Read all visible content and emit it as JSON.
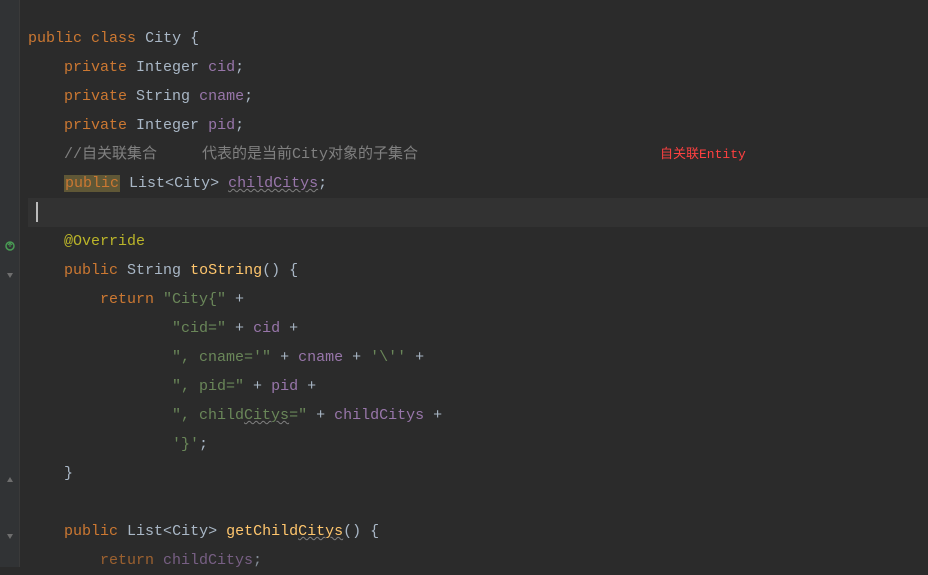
{
  "code": {
    "line1": {
      "kw1": "public",
      "kw2": "class",
      "name": "City",
      "brace": " {"
    },
    "line2": {
      "kw": "private",
      "type": "Integer",
      "field": "cid",
      "semi": ";"
    },
    "line3": {
      "kw": "private",
      "type": "String",
      "field": "cname",
      "semi": ";"
    },
    "line4": {
      "kw": "private",
      "type": "Integer",
      "field": "pid",
      "semi": ";"
    },
    "line5": {
      "comment": "//自关联集合     代表的是当前City对象的子集合"
    },
    "line6": {
      "kw": "public",
      "type1": "List<",
      "type2": "City",
      "type3": ">",
      "field": "childCitys",
      "semi": ";"
    },
    "line7": {
      "ann": "@Override"
    },
    "line8": {
      "kw": "public",
      "type": "String",
      "method": "toString",
      "parens": "()",
      "brace": " {"
    },
    "line9": {
      "kw": "return ",
      "str": "\"City{\"",
      "op": " +"
    },
    "line10": {
      "str": "\"cid=\"",
      "op1": " + ",
      "field": "cid",
      "op2": " +"
    },
    "line11": {
      "str": "\", cname='\"",
      "op1": " + ",
      "field": "cname",
      "op2": " + ",
      "str2": "'\\''",
      "op3": " +"
    },
    "line12": {
      "str": "\", pid=\"",
      "op1": " + ",
      "field": "pid",
      "op2": " +"
    },
    "line13": {
      "str1": "\", child",
      "str2": "Citys",
      "str3": "=\"",
      "op1": " + ",
      "field": "childCitys",
      "op2": " +"
    },
    "line14": {
      "str": "'}'",
      "semi": ";"
    },
    "line15": {
      "brace": "}"
    },
    "line16": {
      "kw": "public",
      "type1": "List<",
      "type2": "City",
      "type3": ">",
      "method": "getChild",
      "method2": "Citys",
      "parens": "()",
      "brace": " {"
    },
    "line17": {
      "kw": "return ",
      "field": "childCitys",
      "semi": ";"
    }
  },
  "annotation": {
    "red_text": "自关联Entity"
  }
}
